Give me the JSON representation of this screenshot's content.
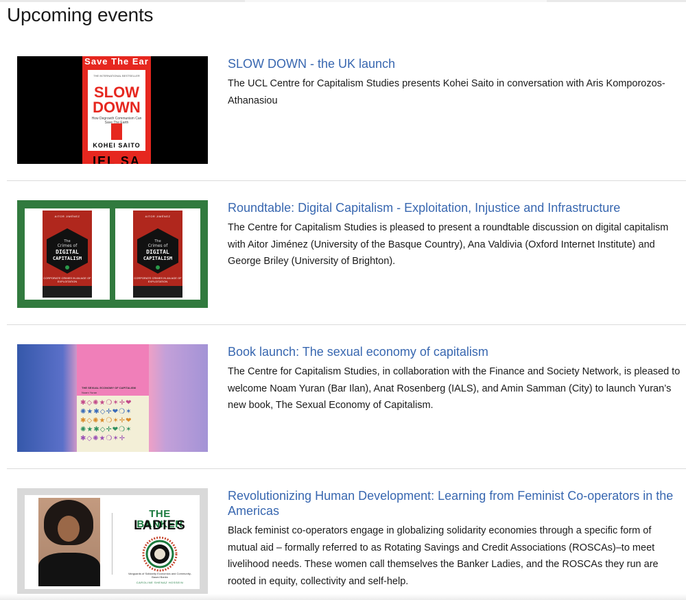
{
  "page": {
    "title": "Upcoming events"
  },
  "events": [
    {
      "title": "SLOW DOWN - the UK launch",
      "description": "The UCL Centre for Capitalism Studies presents Kohei Saito in conversation with Aris Komporozos-Athanasiou",
      "image": {
        "top_text": "Save The Ear",
        "bestseller": "THE INTERNATIONAL BESTSELLER",
        "heading_line1": "SLOW",
        "heading_line2": "DOWN",
        "subtitle": "How Degrowth Communism Can Save The Earth",
        "author": "KOHEI SAITO",
        "bottom_text": "IEL SA"
      }
    },
    {
      "title": "Roundtable: Digital Capitalism - Exploitation, Injustice and Infrastructure",
      "description": "The Centre for Capitalism Studies is pleased to present a roundtable discussion on digital capitalism with Aitor Jiménez (University of the Basque Country), Ana Valdivia (Oxford Internet Institute) and George Briley (University of Brighton).",
      "image": {
        "author": "AITOR JIMÉNEZ",
        "line1": "The",
        "line2": "Crimes of",
        "line3": "DIGITAL",
        "line4": "CAPITALISM",
        "subtitle": "CORPORATE CRIMES IN AN AGE OF EXPLOITATION"
      }
    },
    {
      "title": "Book launch: The sexual economy of capitalism",
      "description": "The Centre for Capitalism Studies, in collaboration with the Finance and Society Network, is pleased to welcome Noam Yuran (Bar Ilan), Anat Rosenberg (IALS), and Amin Samman (City) to launch Yuran’s new book, The Sexual Economy of Capitalism.",
      "image": {
        "book_title": "THE SEXUAL ECONOMY OF CAPITALISM",
        "author": "Noam Yuran",
        "symbols": [
          "✱◇✺★❍✶✛❤",
          "✺★✱◇✛❤❍✶",
          "✱◇✺★❍✶✛❤",
          "✺★✱◇✛❤❍✶",
          "✱◇✺★❍✶✛"
        ]
      }
    },
    {
      "title": "Revolutionizing Human Development: Learning from Feminist Co-operators in the Americas",
      "description": "Black feminist co-operators engage in globalizing solidarity economies through a specific form of mutual aid – formally referred to as Rotating Savings and Credit Associations (ROSCAs)–to meet livelihood needs. These women call themselves the Banker Ladies, and the ROSCAs they run are rooted in equity, collectivity and self-help.",
      "image": {
        "title_line1": "THE BANKER",
        "title_line2": "LADIES",
        "subtitle": "Vanguards of Solidarity Economics and Community-Based Banks",
        "author": "CAROLINE SHENAZ HOSSEIN"
      }
    }
  ]
}
